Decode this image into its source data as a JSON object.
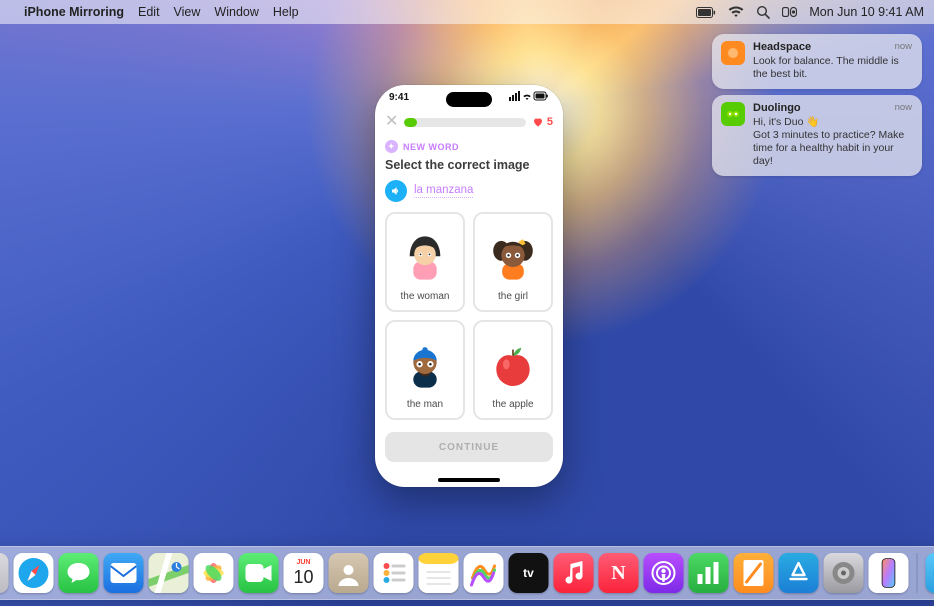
{
  "menubar": {
    "app_name": "iPhone Mirroring",
    "items": [
      "Edit",
      "View",
      "Window",
      "Help"
    ],
    "clock": "Mon Jun 10  9:41 AM"
  },
  "notifications": [
    {
      "app": "Headspace",
      "message": "Look for balance. The middle is the best bit.",
      "time": "now",
      "icon_bg": "#ff8a1f"
    },
    {
      "app": "Duolingo",
      "title_line": "Hi, it's Duo 👋",
      "message": "Got 3 minutes to practice? Make time for a healthy habit in your day!",
      "time": "now",
      "icon_bg": "#58cc02"
    }
  ],
  "phone": {
    "status_time": "9:41",
    "hearts": "5",
    "pill_label": "NEW WORD",
    "prompt": "Select the correct image",
    "word": "la manzana",
    "cards": [
      {
        "label": "the woman"
      },
      {
        "label": "the girl"
      },
      {
        "label": "the man"
      },
      {
        "label": "the apple"
      }
    ],
    "continue_label": "CONTINUE"
  },
  "dock": {
    "apps": [
      {
        "name": "finder",
        "bg": "linear-gradient(#27c3f3,#1e9ee8)",
        "glyph": ""
      },
      {
        "name": "launchpad",
        "bg": "linear-gradient(#d9d9de,#bcbcc2)",
        "glyph": ""
      },
      {
        "name": "safari",
        "bg": "linear-gradient(#29abe2,#1b7fd6)",
        "glyph": ""
      },
      {
        "name": "messages",
        "bg": "linear-gradient(#5ded76,#27c243)",
        "glyph": ""
      },
      {
        "name": "mail",
        "bg": "linear-gradient(#3fa9f5,#1b6fe0)",
        "glyph": ""
      },
      {
        "name": "maps",
        "bg": "linear-gradient(#8fe08a,#52c467)",
        "glyph": ""
      },
      {
        "name": "photos",
        "bg": "#ffffff",
        "glyph": ""
      },
      {
        "name": "facetime",
        "bg": "linear-gradient(#5ded76,#27c243)",
        "glyph": ""
      },
      {
        "name": "calendar",
        "bg": "#ffffff",
        "glyph": "",
        "text_top": "JUN",
        "text_main": "10"
      },
      {
        "name": "contacts",
        "bg": "linear-gradient(#d6c7b1,#b9a98f)",
        "glyph": ""
      },
      {
        "name": "reminders",
        "bg": "#ffffff",
        "glyph": ""
      },
      {
        "name": "notes",
        "bg": "linear-gradient(#ffe27a,#ffd23a)",
        "glyph": ""
      },
      {
        "name": "freeform",
        "bg": "#ffffff",
        "glyph": ""
      },
      {
        "name": "tv",
        "bg": "#111111",
        "glyph": "tv",
        "text_main": "tv"
      },
      {
        "name": "music",
        "bg": "linear-gradient(#ff5c74,#fa233b)",
        "glyph": ""
      },
      {
        "name": "news",
        "bg": "linear-gradient(#ff5c74,#fa233b)",
        "glyph": "N",
        "text_main": "N"
      },
      {
        "name": "podcasts",
        "bg": "linear-gradient(#b84dff,#7d2ae8)",
        "glyph": ""
      },
      {
        "name": "numbers",
        "bg": "linear-gradient(#4cd964,#27ae3f)",
        "glyph": ""
      },
      {
        "name": "pages",
        "bg": "linear-gradient(#ffb03a,#ff8c1e)",
        "glyph": ""
      },
      {
        "name": "appstore",
        "bg": "linear-gradient(#29abe2,#1b7fd6)",
        "glyph": ""
      },
      {
        "name": "settings",
        "bg": "linear-gradient(#d9d9de,#9a9aa0)",
        "glyph": ""
      },
      {
        "name": "iphone-mirroring",
        "bg": "#ffffff",
        "glyph": ""
      }
    ],
    "right_apps": [
      {
        "name": "downloads",
        "bg": "linear-gradient(#5ac8fa,#2a9fe0)",
        "glyph": ""
      },
      {
        "name": "trash",
        "bg": "transparent",
        "glyph": ""
      }
    ]
  }
}
